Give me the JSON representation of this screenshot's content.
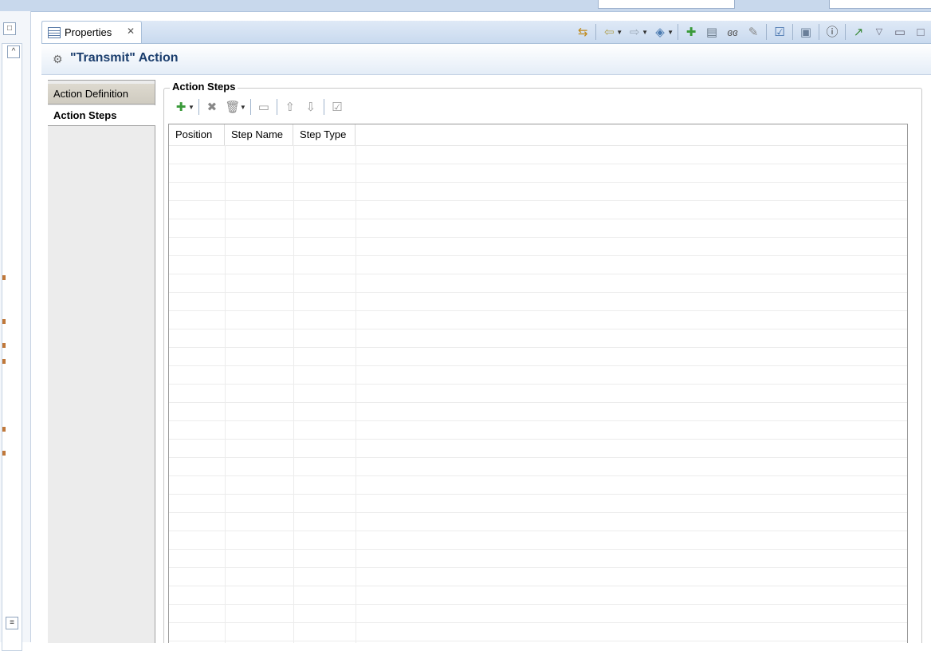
{
  "view_tab": {
    "label": "Properties",
    "close": "✕"
  },
  "title": {
    "text": "\"Transmit\" Action"
  },
  "tabs": [
    {
      "label": "Action Definition"
    },
    {
      "label": "Action Steps"
    }
  ],
  "group": {
    "title": "Action Steps"
  },
  "table": {
    "columns": [
      "Position",
      "Step Name",
      "Step Type"
    ],
    "rows": []
  },
  "colors": {
    "title_text": "#1a3d6d",
    "tabbar": "#c9daef"
  }
}
